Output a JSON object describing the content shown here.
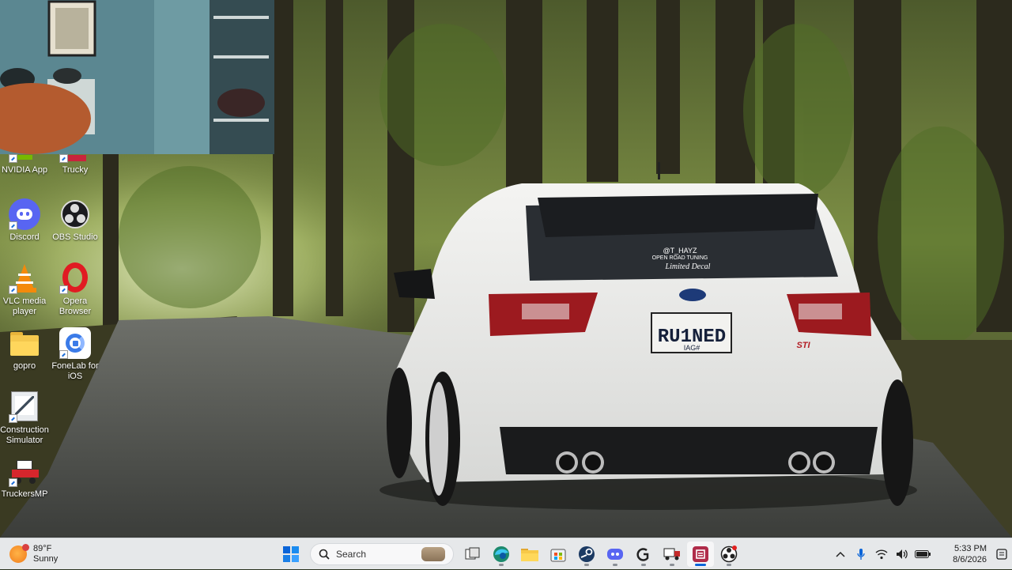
{
  "desktop": {
    "icons": [
      {
        "label": "NVIDIA App",
        "icon": "nvidia-app-icon"
      },
      {
        "label": "Trucky",
        "icon": "trucky-icon"
      },
      {
        "label": "Discord",
        "icon": "discord-icon"
      },
      {
        "label": "OBS Studio",
        "icon": "obs-studio-icon"
      },
      {
        "label": "VLC media player",
        "icon": "vlc-icon"
      },
      {
        "label": "Opera Browser",
        "icon": "opera-icon"
      },
      {
        "label": "gopro",
        "icon": "folder-icon"
      },
      {
        "label": "FoneLab for iOS",
        "icon": "fonelab-icon"
      },
      {
        "label": "Construction Simulator",
        "icon": "construction-simulator-icon"
      },
      {
        "label": "TruckersMP",
        "icon": "truckersmp-icon"
      }
    ],
    "wallpaper": {
      "license_plate": "RU1NED",
      "plate_sub": "IAG#",
      "decal_line1": "@T_HAYZ",
      "decal_line2": "OPEN ROAD TUNING",
      "decal_line3": "Limited Decal",
      "badge": "STI"
    }
  },
  "taskbar": {
    "weather": {
      "temp": "89°F",
      "condition": "Sunny"
    },
    "search": {
      "label": "Search"
    },
    "apps": [
      "windows-start-icon",
      "task-view-icon",
      "edge-icon",
      "file-explorer-icon",
      "store-icon",
      "steam-icon",
      "discord-icon",
      "logitech-icon",
      "euro-truck-icon",
      "recorder-icon",
      "obs-icon"
    ],
    "clock": {
      "time": "5:33 PM",
      "date": "8/6/2026"
    }
  },
  "colors": {
    "taskbar_bg": "#e6e8ea",
    "accent": "#0a64d8",
    "discord": "#5865f2",
    "opera": "#e11b22"
  }
}
